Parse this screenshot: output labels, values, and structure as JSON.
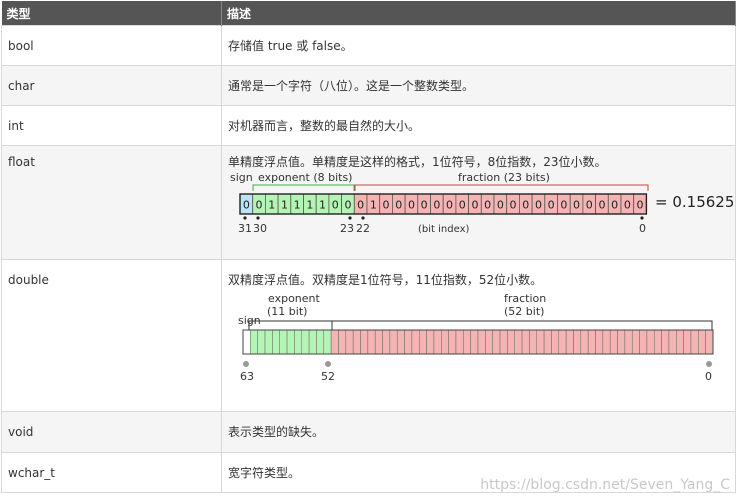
{
  "header": {
    "col_type": "类型",
    "col_desc": "描述"
  },
  "rows": [
    {
      "type": "bool",
      "desc": "存储值 true 或 false。"
    },
    {
      "type": "char",
      "desc": "通常是一个字符（八位）。这是一个整数类型。"
    },
    {
      "type": "int",
      "desc": "对机器而言，整数的最自然的大小。"
    },
    {
      "type": "float",
      "desc": "单精度浮点值。单精度是这样的格式，1位符号，8位指数，23位小数。"
    },
    {
      "type": "double",
      "desc": "双精度浮点值。双精度是1位符号，11位指数，52位小数。"
    },
    {
      "type": "void",
      "desc": "表示类型的缺失。"
    },
    {
      "type": "wchar_t",
      "desc": "宽字符类型。"
    }
  ],
  "float_diagram": {
    "sign_label": "sign",
    "exponent_label": "exponent (8 bits)",
    "fraction_label": "fraction (23 bits)",
    "bits": [
      "0",
      "0",
      "1",
      "1",
      "1",
      "1",
      "1",
      "0",
      "0",
      "0",
      "1",
      "0",
      "0",
      "0",
      "0",
      "0",
      "0",
      "0",
      "0",
      "0",
      "0",
      "0",
      "0",
      "0",
      "0",
      "0",
      "0",
      "0",
      "0",
      "0",
      "0",
      "0"
    ],
    "result": "= 0.15625",
    "index_31": "31",
    "index_30": "30",
    "index_23": "23",
    "index_22": "22",
    "index_0": "0",
    "bit_index_label": "(bit index)",
    "colors": {
      "sign": "#b8e4f4",
      "exponent": "#b4f4b4",
      "fraction": "#f4b4b4"
    }
  },
  "double_diagram": {
    "sign_label": "sign",
    "exponent_label": "exponent",
    "exponent_bits": "(11 bit)",
    "fraction_label": "fraction",
    "fraction_bits": "(52 bit)",
    "index_63": "63",
    "index_52": "52",
    "index_0": "0",
    "colors": {
      "sign": "#ffffff",
      "exponent": "#b4f4b4",
      "fraction": "#f4b4b4"
    }
  },
  "watermark": "https://blog.csdn.net/Seven_Yang_C"
}
